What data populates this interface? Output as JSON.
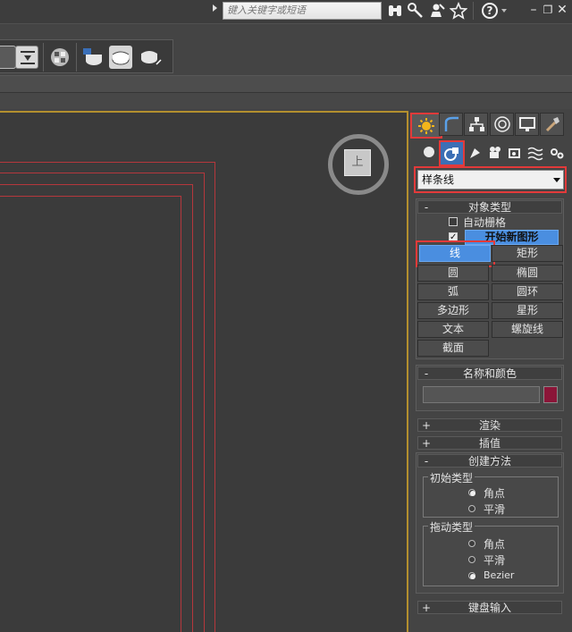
{
  "titlebar": {
    "search_placeholder": "键入关键字或短语",
    "icons": [
      "binoculars-icon",
      "key-icon",
      "user-access-icon",
      "favorite-star-icon",
      "help-icon"
    ],
    "window_controls": [
      "minimize",
      "restore",
      "close"
    ],
    "help_glyph": "?",
    "minimize_glyph": "–",
    "restore_glyph": "❐",
    "close_glyph": "✕"
  },
  "viewport": {
    "viewcube_label": "上"
  },
  "command_panel": {
    "tabs": [
      "create-tab",
      "modify-tab",
      "hierarchy-tab",
      "motion-tab",
      "display-tab",
      "utilities-tab"
    ],
    "subcategories": [
      "geometry-icon",
      "shapes-icon",
      "lights-icon",
      "cameras-icon",
      "helpers-icon",
      "space-warps-icon",
      "systems-icon"
    ],
    "category_dropdown": "样条线",
    "object_type": {
      "title": "对象类型",
      "sign": "-",
      "auto_grid": "自动栅格",
      "start_new_shape": "开始新图形",
      "buttons": [
        [
          "线",
          "矩形"
        ],
        [
          "圆",
          "椭圆"
        ],
        [
          "弧",
          "圆环"
        ],
        [
          "多边形",
          "星形"
        ],
        [
          "文本",
          "螺旋线"
        ],
        [
          "截面"
        ]
      ],
      "active": "线"
    },
    "name_color": {
      "title": "名称和颜色",
      "sign": "-",
      "name_value": "",
      "swatch_color": "#8b1538"
    },
    "rendering": {
      "title": "渲染",
      "sign": "+"
    },
    "interpolation": {
      "title": "插值",
      "sign": "+"
    },
    "creation_method": {
      "title": "创建方法",
      "sign": "-",
      "initial_type": {
        "title": "初始类型",
        "options": [
          "角点",
          "平滑"
        ],
        "selected": "角点"
      },
      "drag_type": {
        "title": "拖动类型",
        "options": [
          "角点",
          "平滑",
          "Bezier"
        ],
        "selected": "Bezier"
      }
    },
    "keyboard_entry": {
      "title": "键盘输入",
      "sign": "+"
    }
  }
}
